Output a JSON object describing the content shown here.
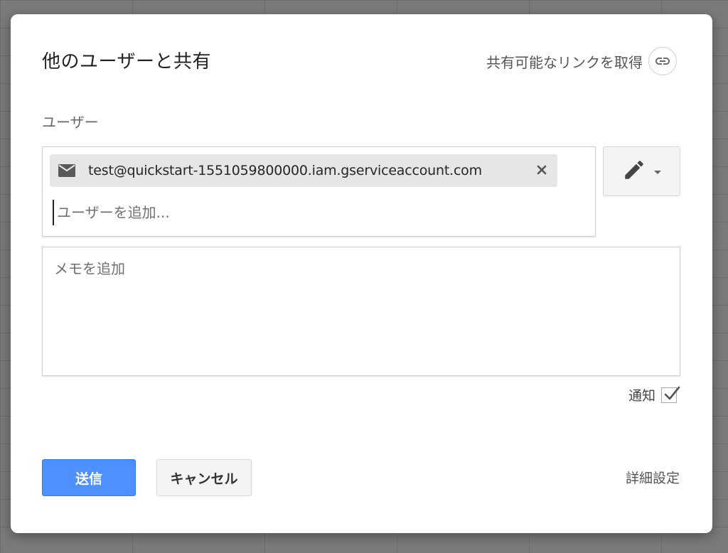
{
  "dialog": {
    "title": "他のユーザーと共有",
    "get_link_label": "共有可能なリンクを取得",
    "users_label": "ユーザー",
    "chip": {
      "email": "test@quickstart-1551059800000.iam.gserviceaccount.com",
      "icon": "mail-icon",
      "remove_icon": "close-icon"
    },
    "add_user_placeholder": "ユーザーを追加...",
    "permission_icon": "pencil-icon",
    "memo_placeholder": "メモを追加",
    "notify_label": "通知",
    "notify_checked": true,
    "send_label": "送信",
    "cancel_label": "キャンセル",
    "advanced_label": "詳細設定"
  },
  "colors": {
    "primary": "#4d90fe",
    "backdrop": "#7a7a7a"
  }
}
